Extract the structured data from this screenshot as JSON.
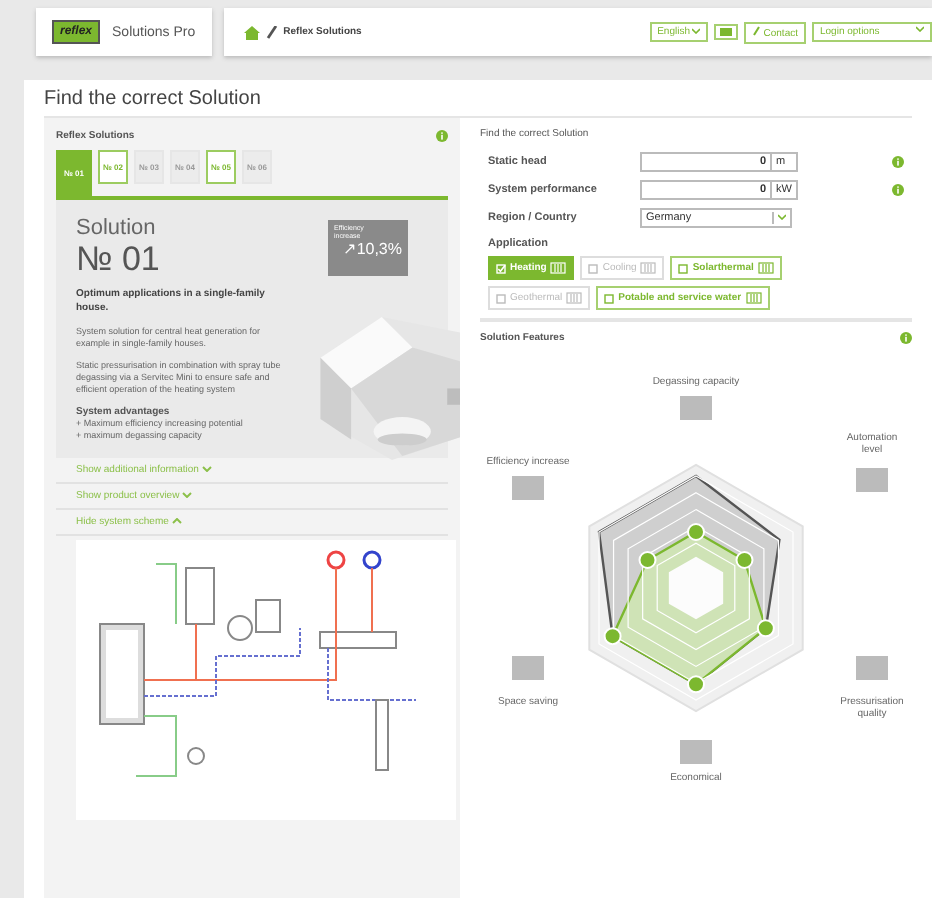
{
  "header": {
    "logo": "reflex",
    "product": "Solutions Pro",
    "breadcrumb": "Reflex Solutions",
    "language": "English",
    "contact": "Contact",
    "login": "Login options"
  },
  "page_title": "Find the correct Solution",
  "solutions": {
    "heading": "Reflex Solutions",
    "tabs": [
      {
        "label": "№ 01",
        "selected": true,
        "disabled": false
      },
      {
        "label": "№ 02",
        "selected": false,
        "disabled": false
      },
      {
        "label": "№ 03",
        "selected": false,
        "disabled": true
      },
      {
        "label": "№ 04",
        "selected": false,
        "disabled": true
      },
      {
        "label": "№ 05",
        "selected": false,
        "disabled": false
      },
      {
        "label": "№ 06",
        "selected": false,
        "disabled": true
      }
    ],
    "card": {
      "title": "Solution",
      "number": "№ 01",
      "badge_label": "Efficiency increase",
      "badge_value": "↗10,3%",
      "lead": "Optimum applications in a single-family house.",
      "paragraphs": [
        "System solution for central heat generation for example in single-family houses.",
        "Static pressurisation in combination with spray tube degassing via a Servitec Mini to ensure safe and efficient operation of the heating system"
      ],
      "advantages_title": "System advantages",
      "advantages": [
        "+ Maximum efficiency increasing potential",
        "+ maximum degassing capacity"
      ]
    },
    "links": [
      {
        "label": "Show additional information",
        "expanded": false
      },
      {
        "label": "Show product overview",
        "expanded": false
      },
      {
        "label": "Hide system scheme",
        "expanded": true
      }
    ]
  },
  "finder": {
    "heading": "Find the correct Solution",
    "fields": [
      {
        "kind": "number",
        "label": "Static head",
        "value": "0",
        "unit": "m",
        "info": true
      },
      {
        "kind": "number",
        "label": "System performance",
        "value": "0",
        "unit": "kW",
        "info": true
      },
      {
        "kind": "select",
        "label": "Region / Country",
        "value": "Germany",
        "info": false
      }
    ],
    "application_label": "Application",
    "applications": [
      {
        "label": "Heating",
        "checked": true,
        "disabled": false
      },
      {
        "label": "Cooling",
        "checked": false,
        "disabled": true
      },
      {
        "label": "Solarthermal",
        "checked": false,
        "disabled": false
      },
      {
        "label": "Geothermal",
        "checked": false,
        "disabled": true
      },
      {
        "label": "Potable and service water",
        "checked": false,
        "disabled": false
      }
    ]
  },
  "features": {
    "heading": "Solution Features",
    "axes": [
      "Degassing capacity",
      "Automation level",
      "Pressurisation quality",
      "Economical",
      "Space saving",
      "Efficiency increase"
    ]
  }
}
